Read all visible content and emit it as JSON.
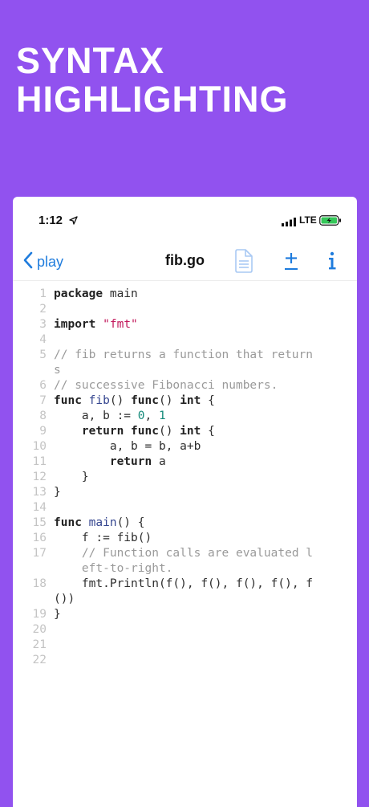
{
  "promo": {
    "line1": "SYNTAX",
    "line2": "HIGHLIGHTING"
  },
  "status_bar": {
    "time": "1:12",
    "carrier": "LTE"
  },
  "nav": {
    "back_label": "play",
    "title": "fib.go"
  },
  "colors": {
    "background": "#9152ef",
    "accent": "#1f7cdd",
    "string": "#c2185b",
    "comment": "#9a9a9a",
    "number": "#148a7a"
  },
  "icons": {
    "location": "location-arrow-icon",
    "signal": "signal-bars-icon",
    "battery": "battery-charging-icon",
    "doc": "document-icon",
    "plusminus": "plus-minus-icon",
    "info": "info-icon",
    "back": "chevron-left-icon"
  },
  "code": [
    {
      "n": "1",
      "tokens": [
        {
          "t": "package",
          "c": "kw"
        },
        {
          "t": " main",
          "c": ""
        }
      ]
    },
    {
      "n": "2",
      "tokens": []
    },
    {
      "n": "3",
      "tokens": [
        {
          "t": "import",
          "c": "kw"
        },
        {
          "t": " ",
          "c": ""
        },
        {
          "t": "\"fmt\"",
          "c": "str"
        }
      ]
    },
    {
      "n": "4",
      "tokens": []
    },
    {
      "n": "5",
      "tokens": [
        {
          "t": "// fib returns a function that return",
          "c": "cmt"
        }
      ]
    },
    {
      "n": "",
      "tokens": [
        {
          "t": "s",
          "c": "cmt"
        }
      ]
    },
    {
      "n": "6",
      "tokens": [
        {
          "t": "// successive Fibonacci numbers.",
          "c": "cmt"
        }
      ]
    },
    {
      "n": "7",
      "tokens": [
        {
          "t": "func",
          "c": "kw"
        },
        {
          "t": " ",
          "c": ""
        },
        {
          "t": "fib",
          "c": "fn"
        },
        {
          "t": "() ",
          "c": ""
        },
        {
          "t": "func",
          "c": "kw"
        },
        {
          "t": "() ",
          "c": ""
        },
        {
          "t": "int",
          "c": "kw"
        },
        {
          "t": " {",
          "c": ""
        }
      ]
    },
    {
      "n": "8",
      "tokens": [
        {
          "t": "    a, b := ",
          "c": ""
        },
        {
          "t": "0",
          "c": "num"
        },
        {
          "t": ", ",
          "c": ""
        },
        {
          "t": "1",
          "c": "num"
        }
      ]
    },
    {
      "n": "9",
      "tokens": [
        {
          "t": "    ",
          "c": ""
        },
        {
          "t": "return",
          "c": "kw"
        },
        {
          "t": " ",
          "c": ""
        },
        {
          "t": "func",
          "c": "kw"
        },
        {
          "t": "() ",
          "c": ""
        },
        {
          "t": "int",
          "c": "kw"
        },
        {
          "t": " {",
          "c": ""
        }
      ]
    },
    {
      "n": "10",
      "tokens": [
        {
          "t": "        a, b = b, a+b",
          "c": ""
        }
      ]
    },
    {
      "n": "11",
      "tokens": [
        {
          "t": "        ",
          "c": ""
        },
        {
          "t": "return",
          "c": "kw"
        },
        {
          "t": " a",
          "c": ""
        }
      ]
    },
    {
      "n": "12",
      "tokens": [
        {
          "t": "    }",
          "c": ""
        }
      ]
    },
    {
      "n": "13",
      "tokens": [
        {
          "t": "}",
          "c": ""
        }
      ]
    },
    {
      "n": "14",
      "tokens": []
    },
    {
      "n": "15",
      "tokens": [
        {
          "t": "func",
          "c": "kw"
        },
        {
          "t": " ",
          "c": ""
        },
        {
          "t": "main",
          "c": "fn"
        },
        {
          "t": "() {",
          "c": ""
        }
      ]
    },
    {
      "n": "16",
      "tokens": [
        {
          "t": "    f := fib()",
          "c": ""
        }
      ]
    },
    {
      "n": "17",
      "tokens": [
        {
          "t": "    ",
          "c": ""
        },
        {
          "t": "// Function calls are evaluated l",
          "c": "cmt"
        }
      ]
    },
    {
      "n": "",
      "tokens": [
        {
          "t": "    ",
          "c": ""
        },
        {
          "t": "eft-to-right.",
          "c": "cmt"
        }
      ]
    },
    {
      "n": "18",
      "tokens": [
        {
          "t": "    fmt.Println(f(), f(), f(), f(), f",
          "c": ""
        }
      ]
    },
    {
      "n": "",
      "tokens": [
        {
          "t": "())",
          "c": ""
        }
      ]
    },
    {
      "n": "19",
      "tokens": [
        {
          "t": "}",
          "c": ""
        }
      ]
    },
    {
      "n": "20",
      "tokens": []
    },
    {
      "n": "21",
      "tokens": []
    },
    {
      "n": "22",
      "tokens": []
    }
  ]
}
